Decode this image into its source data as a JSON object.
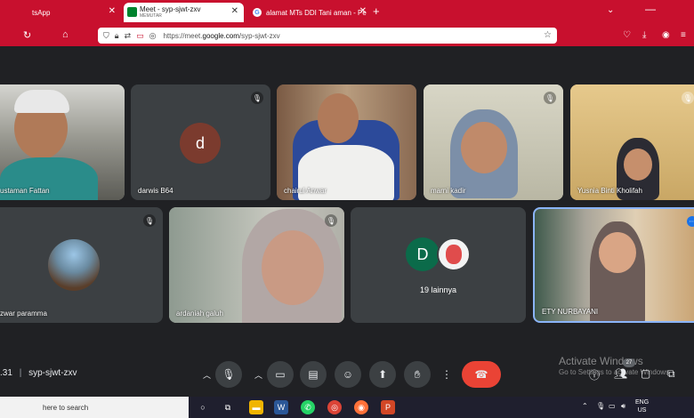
{
  "browser": {
    "tabs": [
      {
        "title": "tsApp"
      },
      {
        "title": "Meet - syp-sjwt-zxv",
        "subtitle": "MEMUTAR"
      },
      {
        "title": "alamat MTs DDI Tani aman - Pe"
      }
    ],
    "url_prefix": "https://meet.",
    "url_domain": "google.com",
    "url_path": "/syp-sjwt-zxv"
  },
  "meeting": {
    "code": "syp-sjwt-zxv",
    "time_fragment": ".31",
    "separator": "|",
    "tiles": [
      {
        "name": "ustaman Fattan"
      },
      {
        "name": "darwis B64",
        "initial": "d"
      },
      {
        "name": "chairul Anwar"
      },
      {
        "name": "marni kadir"
      },
      {
        "name": "Yusnia Binti Kholifah"
      },
      {
        "name": "zwar paramma"
      },
      {
        "name": "ardaniah galuh"
      },
      {
        "name": "19 lainnya",
        "initial": "D"
      },
      {
        "name": "ETY NURBAYANI"
      }
    ],
    "participant_count": "27"
  },
  "watermark": {
    "line1": "Activate Windows",
    "line2": "Go to Settings to activate Windows"
  },
  "taskbar": {
    "search_placeholder": "here to search",
    "lang_top": "ENG",
    "lang_bottom": "US"
  },
  "colors": {
    "chrome_red": "#c8102e",
    "meet_dark": "#202124",
    "tile_gray": "#3c4043",
    "end_call": "#ea4335",
    "active_border": "#8ab4f8"
  }
}
